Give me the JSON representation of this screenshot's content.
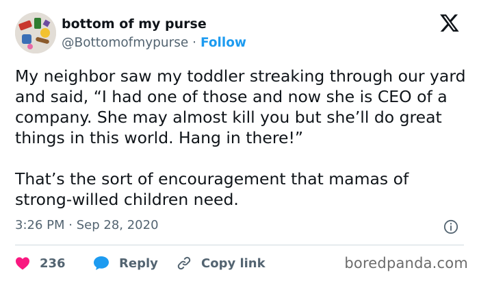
{
  "author": {
    "name": "bottom of my purse",
    "handle": "@Bottomofmypurse",
    "separator": "·",
    "follow_label": "Follow"
  },
  "icons": {
    "brand": "x-logo-icon",
    "info": "info-icon",
    "like": "heart-icon",
    "reply": "reply-bubble-icon",
    "copy": "link-icon"
  },
  "tweet": {
    "text": "My neighbor saw my toddler streaking through our yard and said, “I had one of those and now she is CEO of a company. She may almost kill you but she’ll do great things in this world. Hang in there!”\n\nThat’s the sort of encouragement that mamas of strong-willed children need.",
    "time": "3:26 PM",
    "date_sep": "·",
    "date": "Sep 28, 2020"
  },
  "actions": {
    "like_count": "236",
    "reply_label": "Reply",
    "copy_label": "Copy link"
  },
  "watermark": "boredpanda.com",
  "colors": {
    "text": "#0f1419",
    "muted": "#536471",
    "accent": "#1d9bf0",
    "like": "#f91880",
    "divider": "#cfd9de"
  }
}
